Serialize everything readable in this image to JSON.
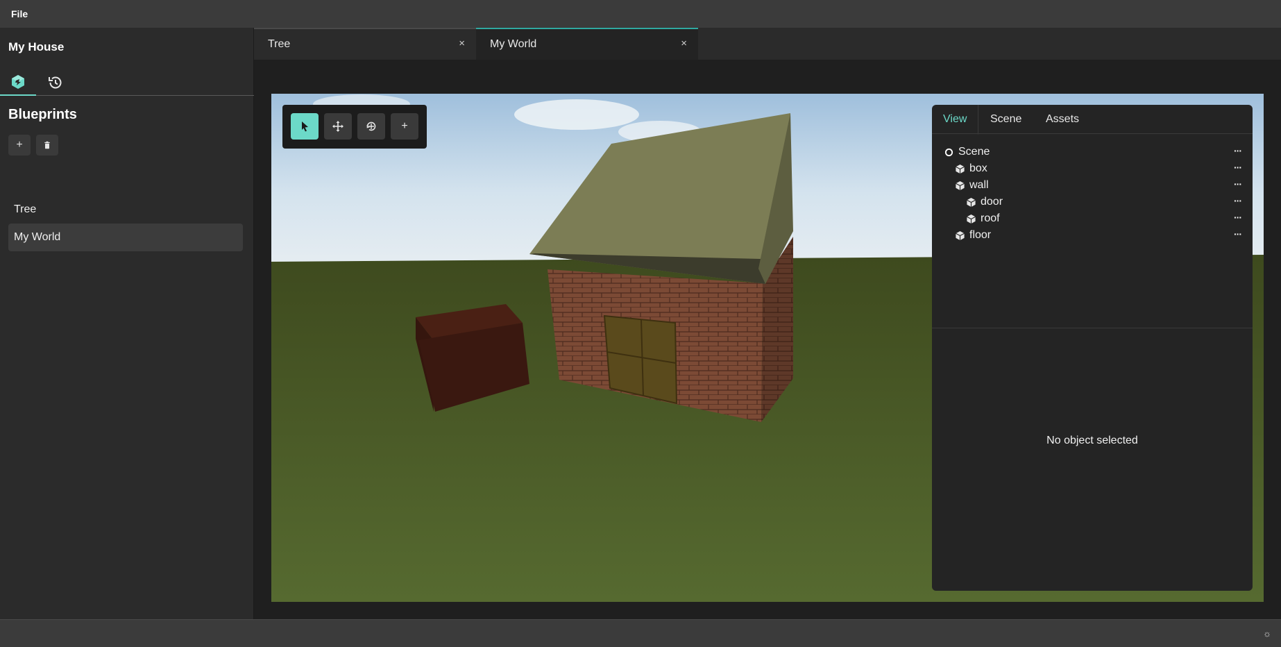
{
  "menubar": {
    "file_label": "File"
  },
  "sidebar": {
    "project_title": "My House",
    "section_title": "Blueprints",
    "add_label": "+",
    "blueprints": [
      {
        "label": "Tree"
      },
      {
        "label": "My World"
      }
    ],
    "selected_blueprint": "My World"
  },
  "tabs": [
    {
      "label": "Tree",
      "close": "×"
    },
    {
      "label": "My World",
      "close": "×"
    }
  ],
  "active_tab": "My World",
  "toolbox": {
    "tools": [
      "select-tool",
      "move-tool",
      "rotate-tool",
      "add-tool"
    ],
    "add_label": "+"
  },
  "inspector": {
    "tabs": [
      {
        "label": "View"
      },
      {
        "label": "Scene"
      },
      {
        "label": "Assets"
      }
    ],
    "active_tab": "View",
    "tree": [
      {
        "label": "Scene",
        "depth": 0,
        "icon": "scene-root-icon",
        "more": "···"
      },
      {
        "label": "box",
        "depth": 1,
        "icon": "cube-icon",
        "more": "···"
      },
      {
        "label": "wall",
        "depth": 1,
        "icon": "cube-icon",
        "more": "···"
      },
      {
        "label": "door",
        "depth": 2,
        "icon": "cube-icon",
        "more": "···"
      },
      {
        "label": "roof",
        "depth": 2,
        "icon": "cube-icon",
        "more": "···"
      },
      {
        "label": "floor",
        "depth": 1,
        "icon": "cube-icon",
        "more": "···"
      }
    ],
    "empty_message": "No object selected"
  },
  "statusbar": {
    "theme_icon": "☼"
  },
  "colors": {
    "accent": "#6cd9c8",
    "tab_accent": "#2fa9a0",
    "ground": "#4a5a2a",
    "sky": "#cfe0ec",
    "roof": "#7c7d55",
    "brick": "#7a4a36",
    "box": "#3c1a12"
  }
}
